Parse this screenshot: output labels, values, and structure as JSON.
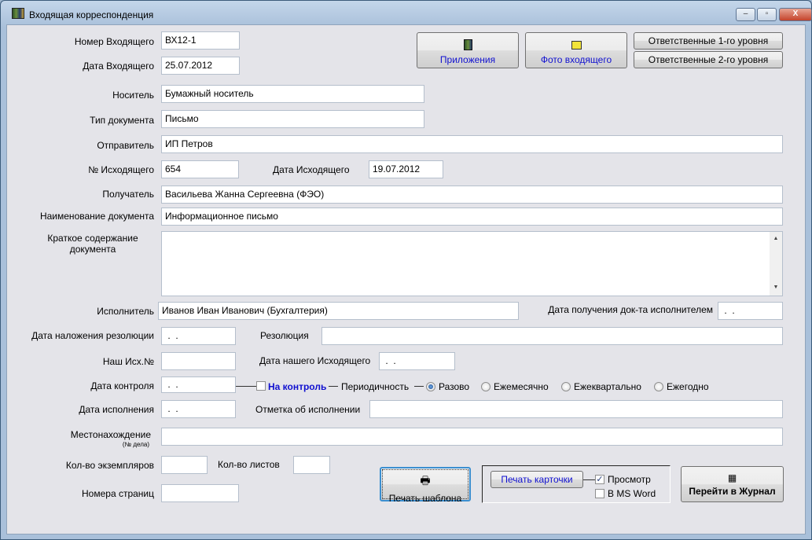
{
  "window": {
    "title": "Входящая корреспонденция",
    "minimize": "‒",
    "maximize": "▫",
    "close": "X"
  },
  "fields": {
    "incoming_no": {
      "label": "Номер Входящего",
      "value": "ВХ12-1"
    },
    "incoming_date": {
      "label": "Дата Входящего",
      "value": "25.07.2012"
    },
    "carrier": {
      "label": "Носитель",
      "value": "Бумажный носитель"
    },
    "doc_type": {
      "label": "Тип документа",
      "value": "Письмо"
    },
    "sender": {
      "label": "Отправитель",
      "value": "ИП Петров"
    },
    "outgoing_no": {
      "label": "№ Исходящего",
      "value": "654"
    },
    "outgoing_date": {
      "label": "Дата Исходящего",
      "value": "19.07.2012"
    },
    "recipient": {
      "label": "Получатель",
      "value": "Васильева Жанна Сергеевна (ФЭО)"
    },
    "doc_name": {
      "label": "Наименование документа",
      "value": "Информационное письмо"
    },
    "summary": {
      "label1": "Краткое содержание",
      "label2": "документа",
      "value": ""
    },
    "executor": {
      "label": "Исполнитель",
      "value": "Иванов Иван Иванович (Бухгалтерия)"
    },
    "executor_received_date": {
      "label": "Дата получения док-та исполнителем",
      "value": " .  ."
    },
    "resolution_date": {
      "label": "Дата наложения резолюции",
      "value": " .  ."
    },
    "resolution": {
      "label": "Резолюция",
      "value": ""
    },
    "our_out_no": {
      "label": "Наш Исх.№",
      "value": ""
    },
    "our_out_date": {
      "label": "Дата нашего Исходящего",
      "value": " .  ."
    },
    "control_date": {
      "label": "Дата контроля",
      "value": " .  ."
    },
    "execution_date": {
      "label": "Дата исполнения",
      "value": " .  ."
    },
    "execution_mark": {
      "label": "Отметка об исполнении",
      "value": ""
    },
    "location": {
      "label": "Местонахождение",
      "sublabel": "(№ дела)",
      "value": ""
    },
    "copies": {
      "label": "Кол-во экземпляров",
      "value": ""
    },
    "sheets": {
      "label": "Кол-во листов",
      "value": ""
    },
    "pages": {
      "label": "Номера страниц",
      "value": ""
    }
  },
  "control": {
    "checkbox_label": "На контроль",
    "checked": false,
    "periodicity_label": "Периодичность",
    "options": [
      "Разово",
      "Ежемесячно",
      "Ежеквартально",
      "Ежегодно"
    ],
    "selected": "Разово"
  },
  "buttons": {
    "attachments": "Приложения",
    "photo": "Фото входящего",
    "responsible1": "Ответственные 1-го уровня",
    "responsible2": "Ответственные 2-го уровня",
    "print_template": "Печать шаблона",
    "print_card": "Печать карточки",
    "go_journal": "Перейти в Журнал"
  },
  "print_options": {
    "preview": {
      "label": "Просмотр",
      "checked": true
    },
    "ms_word": {
      "label": "В MS Word",
      "checked": false
    }
  },
  "colors": {
    "link_blue": "#1010d0",
    "background": "#e4e4e9"
  }
}
